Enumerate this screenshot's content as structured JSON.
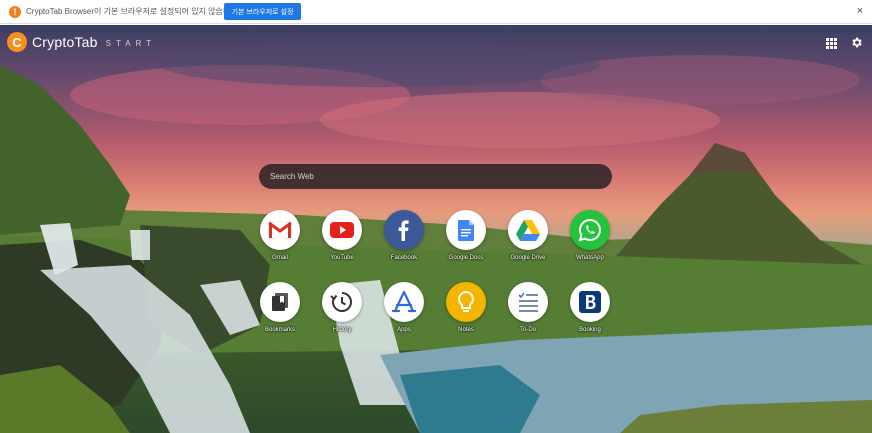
{
  "infobar": {
    "message": "CryptoTab Browser이 기본 브라우저로 설정되어 있지 않습니다",
    "button_label": "기본 브라우저로 설정",
    "close_glyph": "×",
    "info_glyph": "!"
  },
  "header": {
    "logo_glyph": "C",
    "brand_name": "CryptoTab",
    "brand_sub": "START"
  },
  "search": {
    "placeholder": "Search Web",
    "value": ""
  },
  "shortcuts": {
    "row1": [
      {
        "label": "Gmail",
        "icon": "gmail-icon"
      },
      {
        "label": "YouTube",
        "icon": "youtube-icon"
      },
      {
        "label": "Facebook",
        "icon": "facebook-icon"
      },
      {
        "label": "Google Docs",
        "icon": "google-docs-icon"
      },
      {
        "label": "Google Drive",
        "icon": "google-drive-icon"
      },
      {
        "label": "WhatsApp",
        "icon": "whatsapp-icon"
      }
    ],
    "row2": [
      {
        "label": "Bookmarks",
        "icon": "bookmarks-icon"
      },
      {
        "label": "History",
        "icon": "history-icon"
      },
      {
        "label": "Apps",
        "icon": "apps-icon"
      },
      {
        "label": "Notes",
        "icon": "notes-icon"
      },
      {
        "label": "To-Do",
        "icon": "todo-icon"
      },
      {
        "label": "Booking",
        "icon": "booking-icon"
      }
    ]
  },
  "colors": {
    "brand": "#f6911e",
    "infobar_button": "#1f78e6",
    "youtube": "#e62117",
    "facebook": "#3b5998",
    "whatsapp": "#25c33d",
    "notes": "#f5b400",
    "booking": "#0b3a7a"
  }
}
